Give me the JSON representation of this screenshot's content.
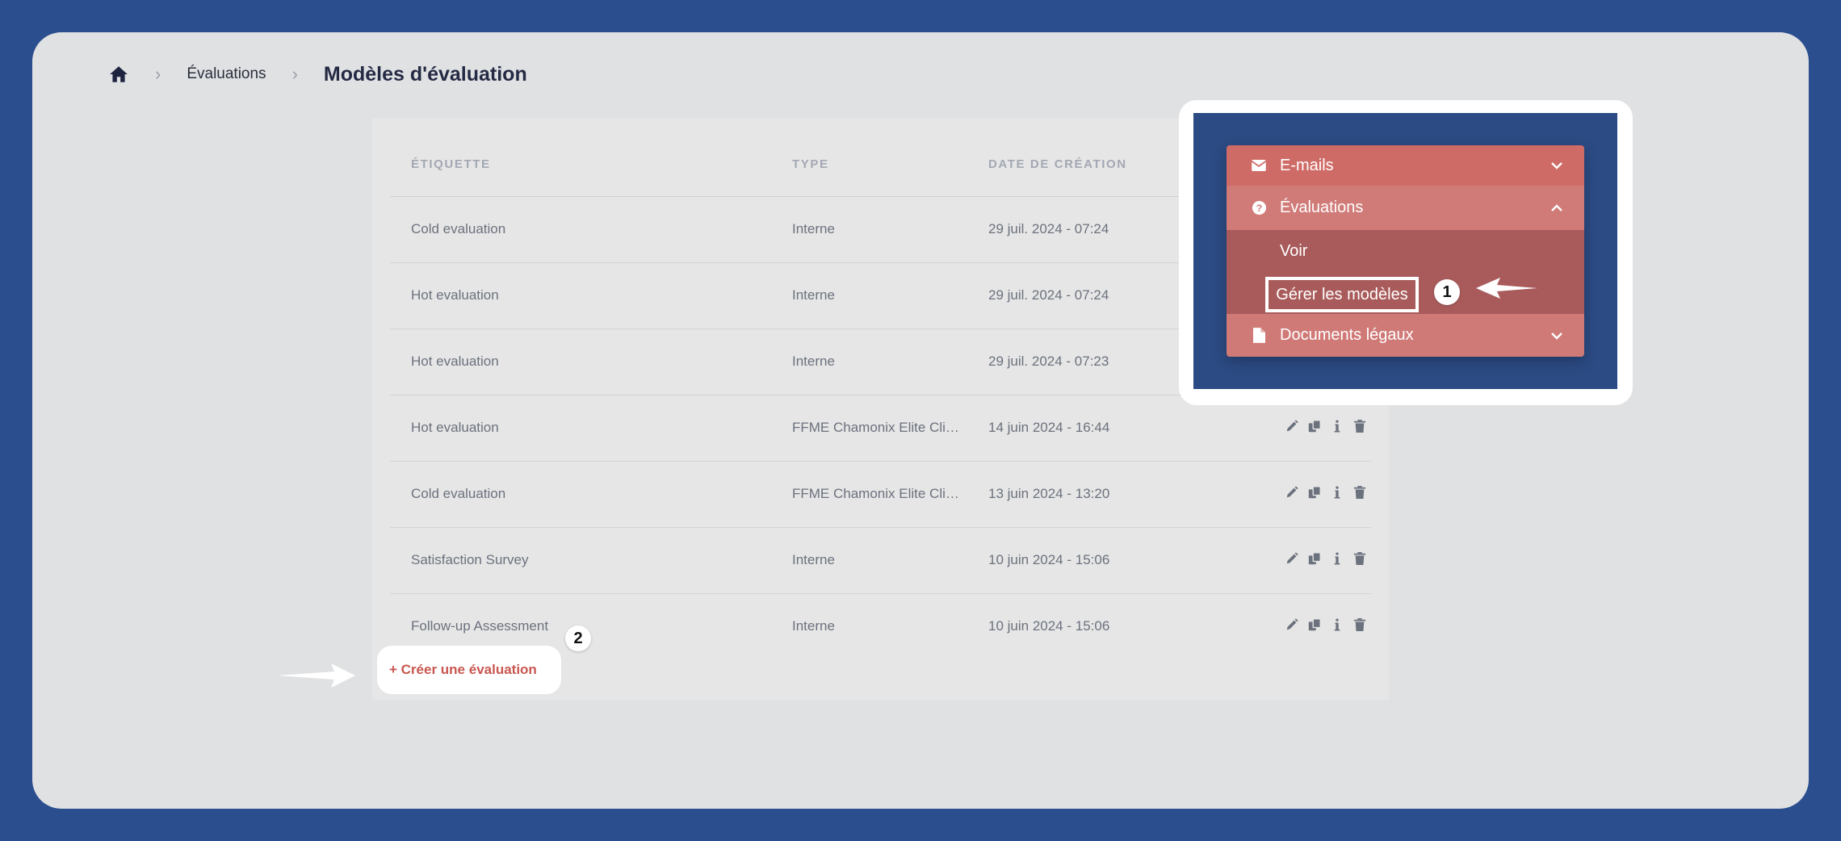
{
  "breadcrumb": {
    "home_icon": "home-icon",
    "link": "Évaluations",
    "current": "Modèles d'évaluation"
  },
  "table": {
    "headers": {
      "label": "ÉTIQUETTE",
      "type": "TYPE",
      "date": "DATE DE CRÉATION"
    },
    "rows": [
      {
        "label": "Cold evaluation",
        "type": "Interne",
        "date": "29 juil. 2024 - 07:24",
        "actions": false
      },
      {
        "label": "Hot evaluation",
        "type": "Interne",
        "date": "29 juil. 2024 - 07:24",
        "actions": false
      },
      {
        "label": "Hot evaluation",
        "type": "Interne",
        "date": "29 juil. 2024 - 07:23",
        "actions": false
      },
      {
        "label": "Hot evaluation",
        "type": "FFME Chamonix Elite Climb...",
        "date": "14 juin 2024 - 16:44",
        "actions": true
      },
      {
        "label": "Cold evaluation",
        "type": "FFME Chamonix Elite Climb...",
        "date": "13 juin 2024 - 13:20",
        "actions": true
      },
      {
        "label": "Satisfaction Survey",
        "type": "Interne",
        "date": "10 juin 2024 - 15:06",
        "actions": true
      },
      {
        "label": "Follow-up Assessment",
        "type": "Interne",
        "date": "10 juin 2024 - 15:06",
        "actions": true
      }
    ],
    "action_icons": [
      "pencil-icon",
      "copy-icon",
      "info-icon",
      "trash-icon"
    ]
  },
  "create_button": "+ Créer une évaluation",
  "menu": {
    "emails": "E-mails",
    "evaluations": "Évaluations",
    "voir": "Voir",
    "gerer": "Gérer les modèles",
    "documents": "Documents légaux"
  },
  "callouts": {
    "step1": "1",
    "step2": "2"
  },
  "colors": {
    "background": "#2a4e8e",
    "accent": "#c9564f",
    "menu_item": "#cf6b67",
    "menu_sub": "#a95b5b"
  }
}
